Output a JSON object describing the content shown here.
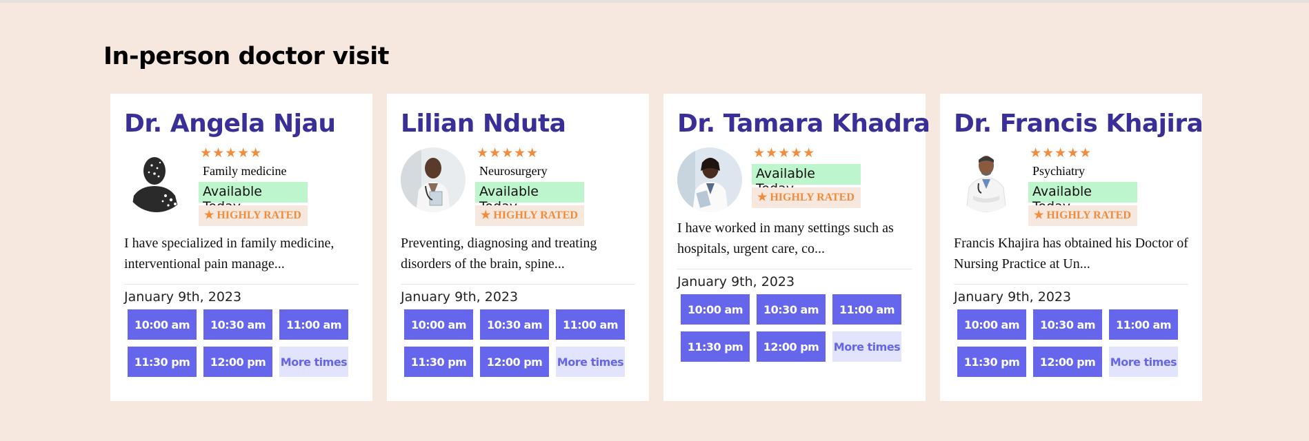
{
  "section": {
    "title": "In-person doctor visit"
  },
  "colors": {
    "background": "#f6e8de",
    "accent": "#6566eb",
    "name": "#3a2f96",
    "star": "#f28c3c",
    "available": "#bdf5cc"
  },
  "doctors": [
    {
      "name": "Dr. Angela Njau",
      "stars": "★★★★★",
      "rating": 5,
      "specialty": "Family medicine",
      "available": "Available Today",
      "rated": "★ HIGHLY RATED",
      "bio": "I have specialized in family medicine, interventional pain manage...",
      "date": "January 9th, 2023",
      "slots": [
        "10:00 am",
        "10:30 am",
        "11:00 am",
        "11:30 pm",
        "12:00 pm"
      ],
      "more": "More times"
    },
    {
      "name": "Lilian Nduta",
      "stars": "★★★★★",
      "rating": 5,
      "specialty": "Neurosurgery",
      "available": "Available Today",
      "rated": "★ HIGHLY RATED",
      "bio": "Preventing, diagnosing and treating disorders of the brain, spine...",
      "date": "January 9th, 2023",
      "slots": [
        "10:00 am",
        "10:30 am",
        "11:00 am",
        "11:30 pm",
        "12:00 pm"
      ],
      "more": "More times"
    },
    {
      "name": "Dr. Tamara Khadra",
      "stars": "★★★★★",
      "rating": 5,
      "specialty": "",
      "available": "Available Today",
      "rated": "★ HIGHLY RATED",
      "bio": "I have worked in many settings such as hospitals, urgent care, co...",
      "date": "January 9th, 2023",
      "slots": [
        "10:00 am",
        "10:30 am",
        "11:00 am",
        "11:30 pm",
        "12:00 pm"
      ],
      "more": "More times"
    },
    {
      "name": "Dr. Francis Khajira",
      "stars": "★★★★★",
      "rating": 5,
      "specialty": "Psychiatry",
      "available": "Available Today",
      "rated": "★ HIGHLY RATED",
      "bio": "Francis Khajira has obtained his Doctor of Nursing Practice at Un...",
      "date": "January 9th, 2023",
      "slots": [
        "10:00 am",
        "10:30 am",
        "11:00 am",
        "11:30 pm",
        "12:00 pm"
      ],
      "more": "More times"
    }
  ]
}
